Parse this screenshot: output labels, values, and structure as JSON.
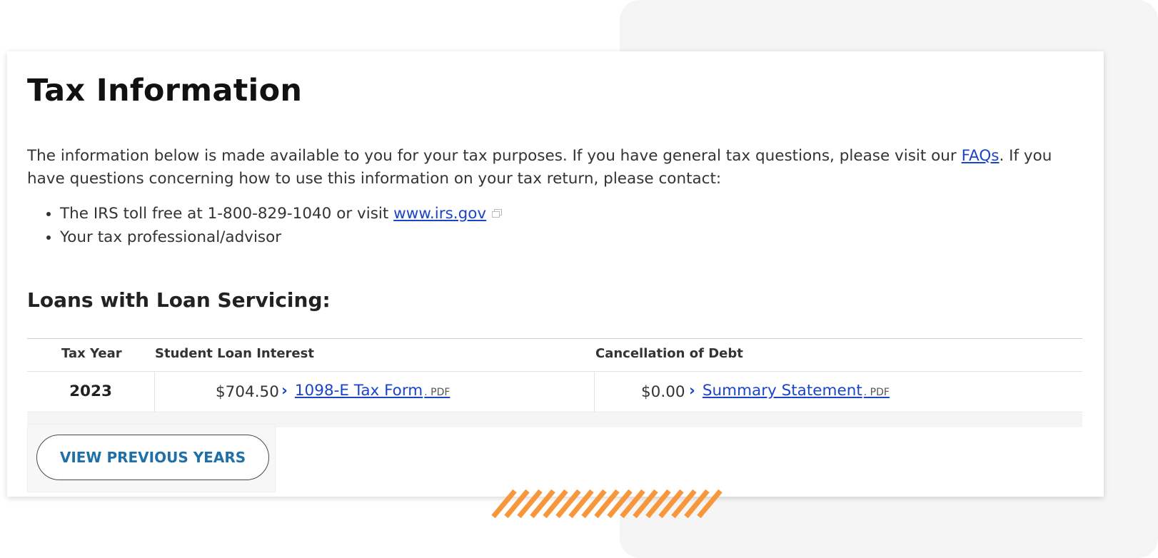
{
  "page": {
    "title": "Tax Information",
    "intro_before_link": "The information below is made available to you for your tax purposes. If you have general tax questions, please visit our ",
    "faq_link": "FAQs",
    "intro_after_link": ". If you have questions concerning how to use this information on your tax return, please contact:",
    "bullets": [
      {
        "prefix": "The IRS toll free at 1-800-829-1040 or visit ",
        "link": "www.irs.gov"
      },
      {
        "prefix": "Your tax professional/advisor"
      }
    ]
  },
  "loans": {
    "title": "Loans with Loan Servicing:",
    "columns": [
      "Tax Year",
      "Student Loan Interest",
      "Cancellation of Debt"
    ],
    "rows": [
      {
        "year": "2023",
        "interest_amount": "$704.50",
        "interest_doc": "1098-E Tax Form",
        "interest_doc_type": ". PDF",
        "debt_amount": "$0.00",
        "debt_doc": "Summary Statement",
        "debt_doc_type": ". PDF"
      }
    ],
    "view_previous_label": "VIEW PREVIOUS YEARS"
  },
  "icons": {
    "external_link": "external-link-icon",
    "chevron": "chevron-right-icon"
  },
  "colors": {
    "link": "#1a45c7",
    "button_text": "#1f6fa8",
    "accent_stripes": "#f7963b"
  }
}
